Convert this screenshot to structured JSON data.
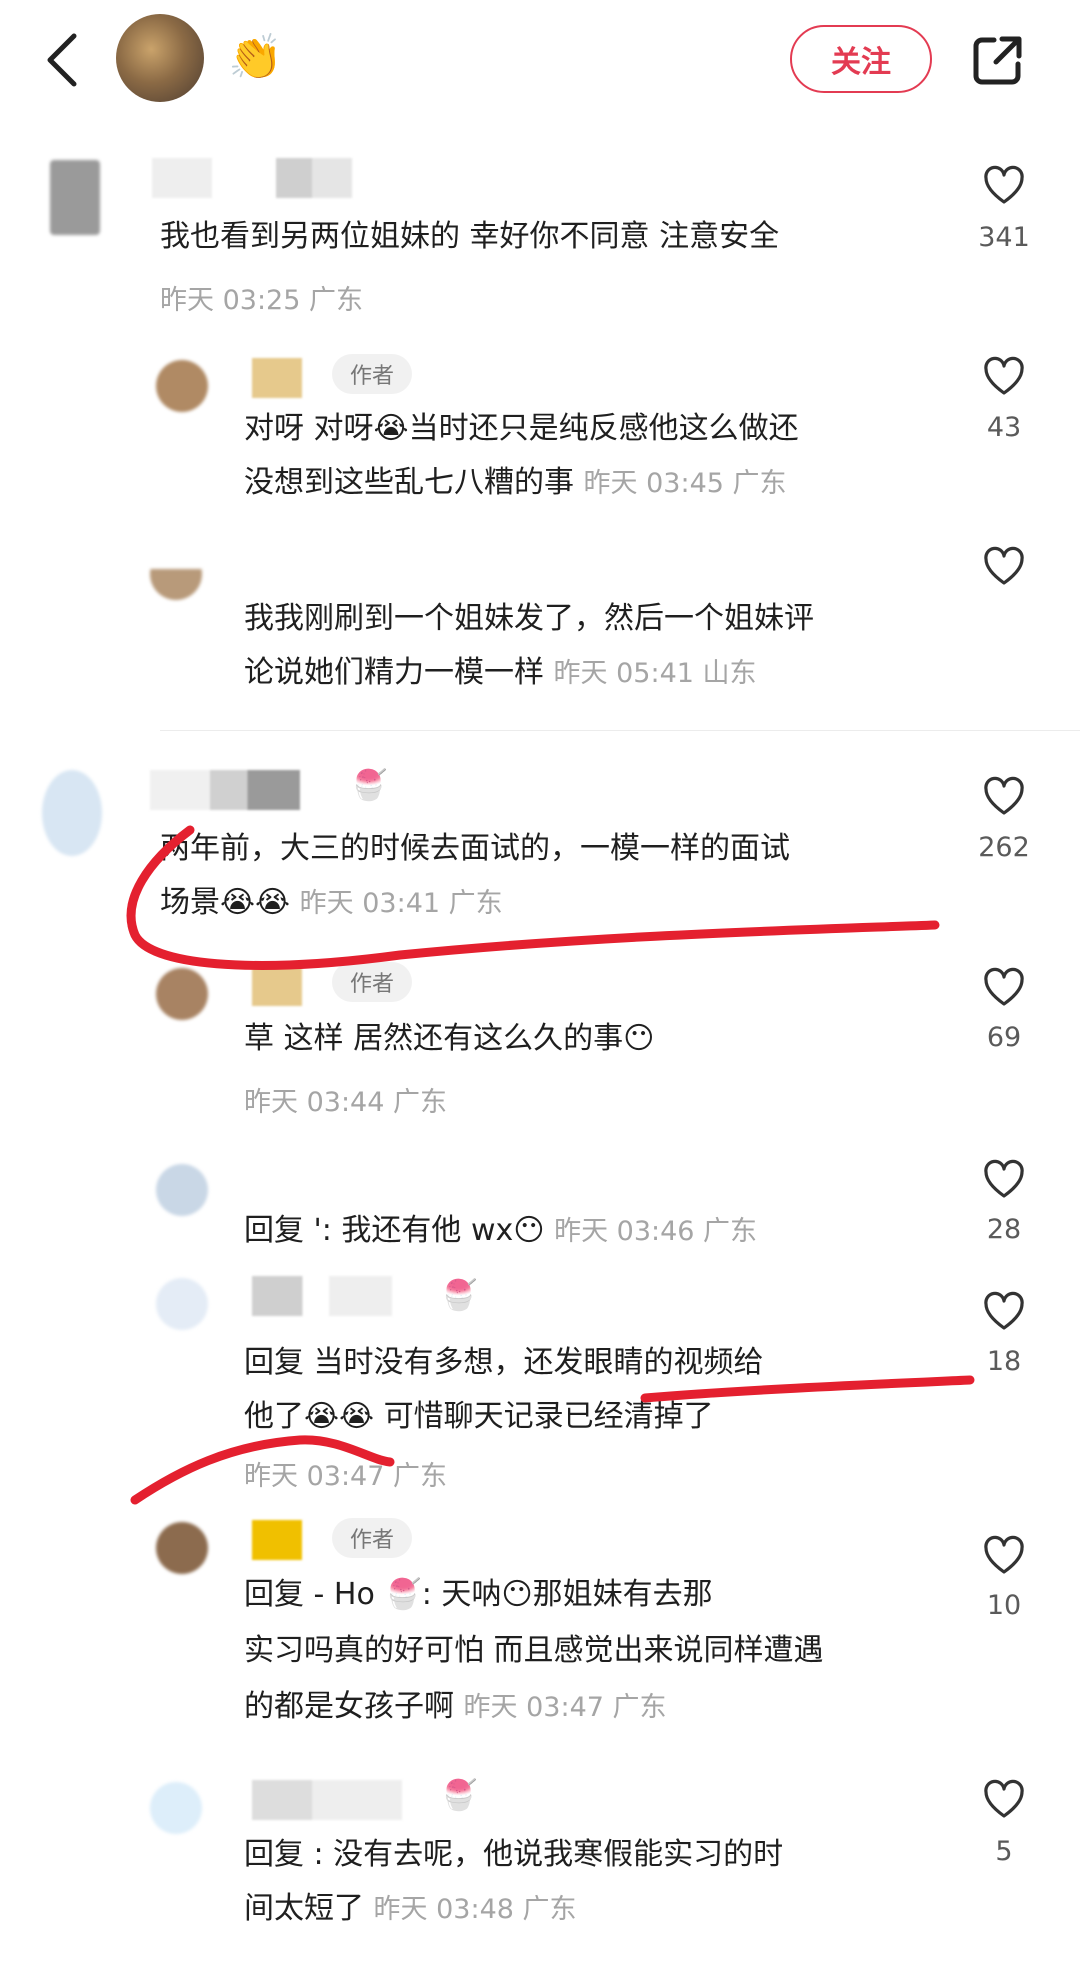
{
  "header": {
    "follow_label": "关注",
    "clap_emoji": "👏"
  },
  "comments": [
    {
      "text_lines": [
        "我也看到另两位姐妹的 幸好你不同意 注意安全"
      ],
      "meta": "昨天 03:25 广东",
      "likes": "341"
    },
    {
      "author_badge": "作者",
      "text_lines": [
        "对呀 对呀😭当时还只是纯反感他这么做还",
        "没想到这些乱七八糟的事"
      ],
      "meta": "昨天 03:45 广东",
      "likes": "43"
    },
    {
      "text_lines": [
        "我我刚刷到一个姐妹发了，然后一个姐妹评",
        "论说她们精力一模一样"
      ],
      "meta": "昨天 05:41 山东",
      "likes": ""
    },
    {
      "text_lines": [
        "两年前，大三的时候去面试的，一模一样的面试",
        "场景😭😭"
      ],
      "meta": "昨天 03:41 广东",
      "likes": "262"
    },
    {
      "author_badge": "作者",
      "text_lines": [
        "草 这样 居然还有这么久的事😶"
      ],
      "meta": "昨天 03:44 广东",
      "likes": "69"
    },
    {
      "text_lines": [
        "回复 ': 我还有他 wx😶"
      ],
      "meta": "昨天 03:46 广东",
      "likes": "28"
    },
    {
      "text_lines": [
        "回复     当时没有多想，还发眼睛的视频给",
        "他了😭😭 可惜聊天记录已经清掉了"
      ],
      "meta": "昨天 03:47 广东",
      "likes": "18"
    },
    {
      "author_badge": "作者",
      "text_lines": [
        "回复 -          Ho 🍧: 天呐😶那姐妹有去那",
        "实习吗真的好可怕 而且感觉出来说同样遭遇",
        "的都是女孩子啊"
      ],
      "meta": "昨天 03:47 广东",
      "likes": "10"
    },
    {
      "text_lines": [
        "回复     : 没有去呢，他说我寒假能实习的时",
        "间太短了"
      ],
      "meta": "昨天 03:48 广东",
      "likes": "5"
    }
  ],
  "colors": {
    "accent": "#e33b52",
    "meta_gray": "#a5a5a5",
    "annotation_red": "#e4202f"
  },
  "icons": [
    "back-icon",
    "share-icon",
    "heart-icon"
  ]
}
